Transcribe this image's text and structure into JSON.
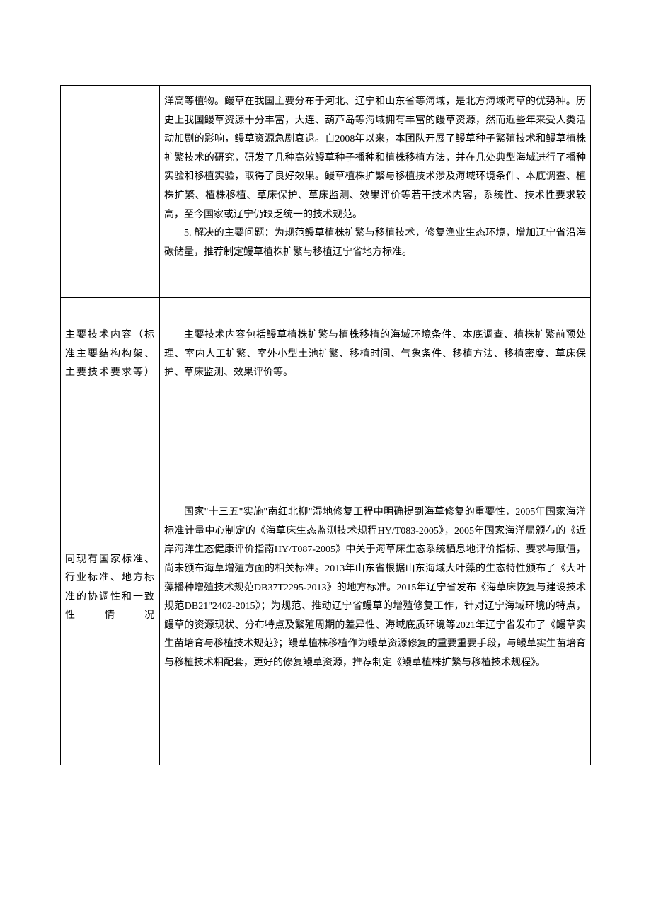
{
  "rows": [
    {
      "label": "",
      "paragraphs": [
        "洋高等植物。鳗草在我国主要分布于河北、辽宁和山东省等海域，是北方海域海草的优势种。历史上我国鳗草资源十分丰富，大连、葫芦岛等海域拥有丰富的鳗草资源，然而近些年来受人类活动加剧的影响，鳗草资源急剧衰退。自2008年以来，本团队开展了鳗草种子繁殖技术和鳗草植株扩繁技术的研究，研发了几种高效鳗草种子播种和植株移植方法，并在几处典型海域进行了播种实验和移植实验，取得了良好效果。鳗草植株扩繁与移植技术涉及海域环境条件、本底调查、植株扩繁、植株移植、草床保护、草床监测、效果评价等若干技术内容，系统性、技术性要求较高，至今国家或辽宁仍缺乏统一的技术规范。",
        "5. 解决的主要问题：为规范鳗草植株扩繁与移植技术，修复渔业生态环境，增加辽宁省沿海碳储量，推荐制定鳗草植株扩繁与移植辽宁省地方标准。"
      ]
    },
    {
      "label": "主要技术内容（标准主要结构构架、主要技术要求等）",
      "paragraphs": [
        "主要技术内容包括鳗草植株扩繁与植株移植的海域环境条件、本底调查、植株扩繁前预处理、室内人工扩繁、室外小型土池扩繁、移植时间、气象条件、移植方法、移植密度、草床保护、草床监测、效果评价等。"
      ]
    },
    {
      "label": "同现有国家标准、行业标准、地方标准的协调性和一致性情况",
      "paragraphs": [
        "国家\"十三五\"实施\"南红北柳\"湿地修复工程中明确提到海草修复的重要性，2005年国家海洋标准计量中心制定的《海草床生态监测技术规程HY/T083-2005》，2005年国家海洋局颁布的《近岸海洋生态健康评价指南HY/T087-2005》中关于海草床生态系统栖息地评价指标、要求与赋值，尚未颁布海草增殖方面的相关标准。2013年山东省根据山东海域大叶藻的生态特性颁布了《大叶藻播种增殖技术规范DB37T2295-2013》的地方标准。2015年辽宁省发布《海草床恢复与建设技术规范DB21\"2402-2015》；为规范、推动辽宁省鳗草的增殖修复工作，针对辽宁海域环境的特点，鳗草的资源现状、分布特点及繁殖周期的差异性、海域底质环境等2021年辽宁省发布了《鳗草实生苗培育与移植技术规范》；鳗草植株移植作为鳗草资源修复的重要重要手段，与鳗草实生苗培育与移植技术相配套，更好的修复鳗草资源，推荐制定《鳗草植株扩繁与移植技术规程》。"
      ]
    }
  ]
}
